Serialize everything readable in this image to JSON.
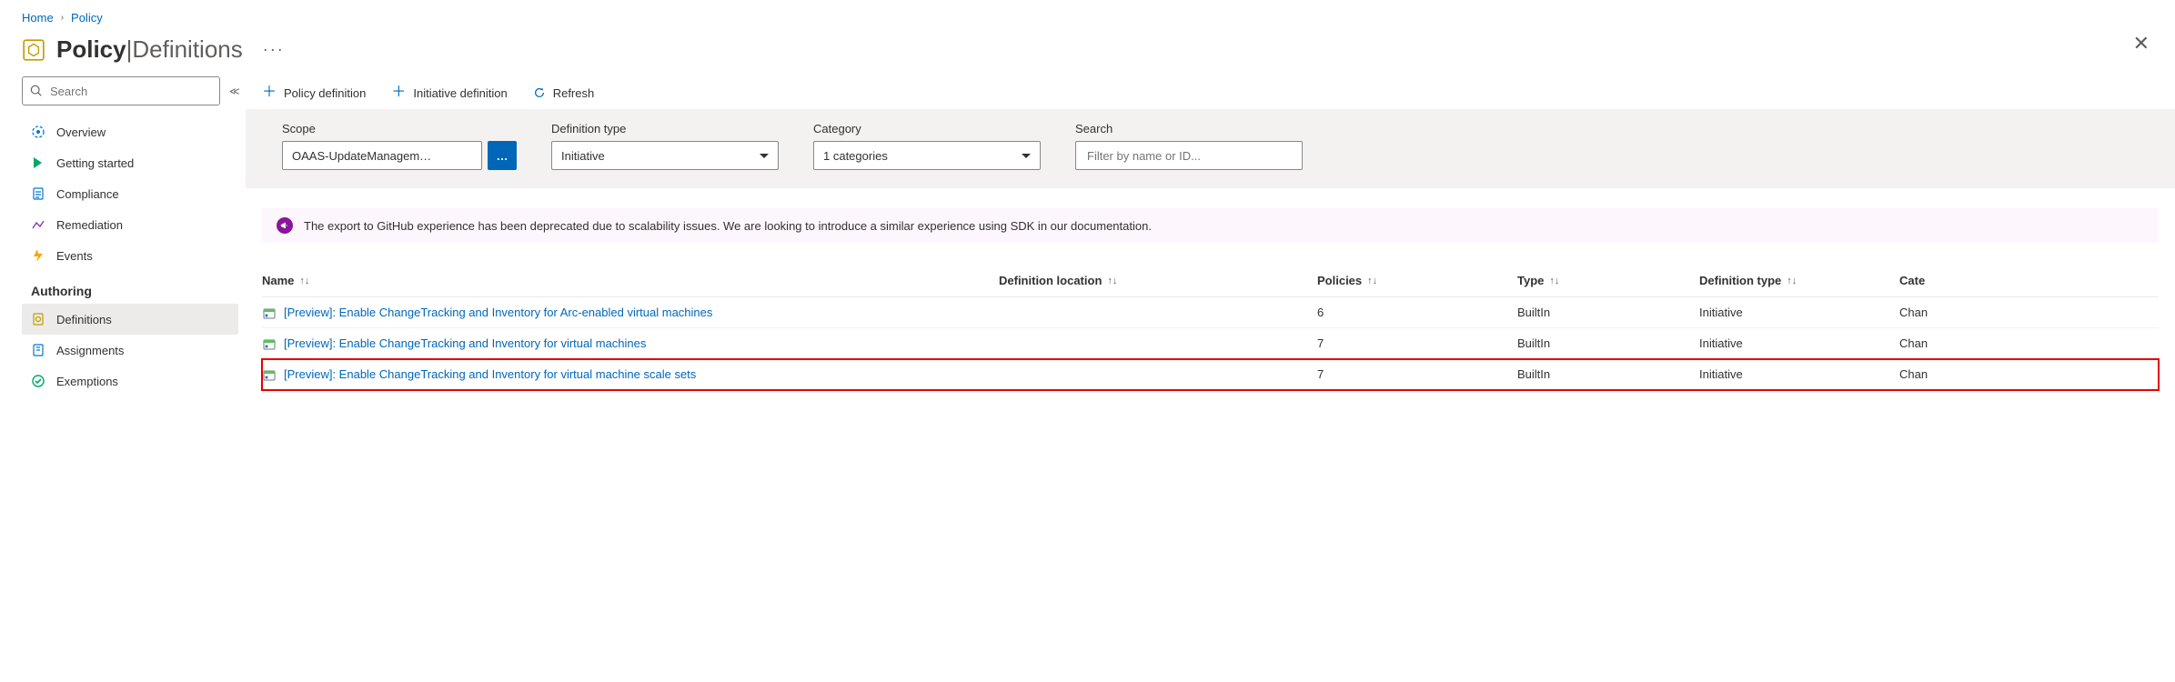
{
  "breadcrumb": {
    "home": "Home",
    "policy": "Policy"
  },
  "header": {
    "title_main": "Policy",
    "title_separator": " | ",
    "title_sub": "Definitions",
    "more": "···"
  },
  "sidebar": {
    "search_placeholder": "Search",
    "items_top": [
      {
        "label": "Overview"
      },
      {
        "label": "Getting started"
      },
      {
        "label": "Compliance"
      },
      {
        "label": "Remediation"
      },
      {
        "label": "Events"
      }
    ],
    "section_title": "Authoring",
    "items_authoring": [
      {
        "label": "Definitions",
        "selected": true
      },
      {
        "label": "Assignments"
      },
      {
        "label": "Exemptions"
      }
    ]
  },
  "toolbar": {
    "policy_def": "Policy definition",
    "initiative_def": "Initiative definition",
    "refresh": "Refresh"
  },
  "filters": {
    "scope_label": "Scope",
    "scope_value": "OAAS-UpdateManagem…",
    "deftype_label": "Definition type",
    "deftype_value": "Initiative",
    "category_label": "Category",
    "category_value": "1 categories",
    "search_label": "Search",
    "search_placeholder": "Filter by name or ID..."
  },
  "notice": {
    "text": "The export to GitHub experience has been deprecated due to scalability issues. We are looking to introduce a similar experience using SDK in our documentation."
  },
  "grid": {
    "columns": {
      "name": "Name",
      "location": "Definition location",
      "policies": "Policies",
      "type": "Type",
      "deftype": "Definition type",
      "category": "Cate"
    },
    "rows": [
      {
        "name": "[Preview]: Enable ChangeTracking and Inventory for Arc-enabled virtual machines",
        "location": "",
        "policies": "6",
        "type": "BuiltIn",
        "deftype": "Initiative",
        "category": "Chan",
        "highlight": false
      },
      {
        "name": "[Preview]: Enable ChangeTracking and Inventory for virtual machines",
        "location": "",
        "policies": "7",
        "type": "BuiltIn",
        "deftype": "Initiative",
        "category": "Chan",
        "highlight": false
      },
      {
        "name": "[Preview]: Enable ChangeTracking and Inventory for virtual machine scale sets",
        "location": "",
        "policies": "7",
        "type": "BuiltIn",
        "deftype": "Initiative",
        "category": "Chan",
        "highlight": true
      }
    ]
  }
}
